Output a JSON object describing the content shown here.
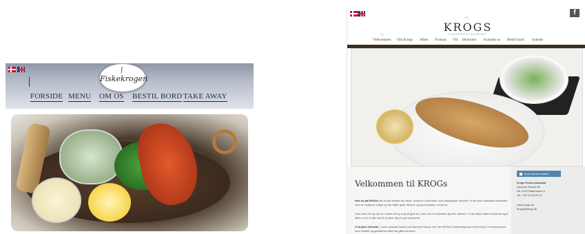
{
  "left_site": {
    "logo_text": "Fiskekrogen",
    "nav": [
      "FORSIDE",
      "MENU",
      "OM OS",
      "BESTIL BORD",
      "TAKE AWAY"
    ]
  },
  "right_site": {
    "logo": "KROGS",
    "logo_sub": "FISKERESTAURANT",
    "nav": [
      "Velkommen",
      "Om Krogs",
      "Aften",
      "Frokost",
      "Vin",
      "Historien",
      "Kontakt os",
      "Bestil bord",
      "nyhede"
    ],
    "facebook_icon": "f",
    "welcome_title": "Velkommen til KROGs",
    "paragraphs": [
      {
        "lead": "Hos os på KROGs",
        "text": " får du det bedste fra havet, serveret i historiske, men afslappede rammer. Vi serverer klassiske fiskeretter med et moderne udtryk og har både gode råvarer og godt selskab i centrum."
      },
      {
        "lead": "",
        "text": "Kom bare ind og nyd en enkelt ret og et godt glas vin, eller ned en forkælte dig hele aftenen. Vi har åbent både til frokost og til aften, hvor vi står klar til at sikre dig en god oplevelse."
      },
      {
        "lead": "Vi bryder rekorder",
        "text": " i vores smukke lokaler på Gammel Strand. Her har KROGs Fiskerestaurant haft til huse i et århundrede, hvor kvalitet og gæstfrihed altid har gået sammen."
      }
    ],
    "book_button": "Book dit bord online",
    "sidebar": {
      "name": "Krogs Fiskerestaurant",
      "address1": "Gammel Strand 38",
      "address2": "DK-1202 København K",
      "phone": "Tel: +45 33 15 89 15",
      "web": "www.krogs.dk",
      "email": "krogs@krogs.dk"
    }
  }
}
